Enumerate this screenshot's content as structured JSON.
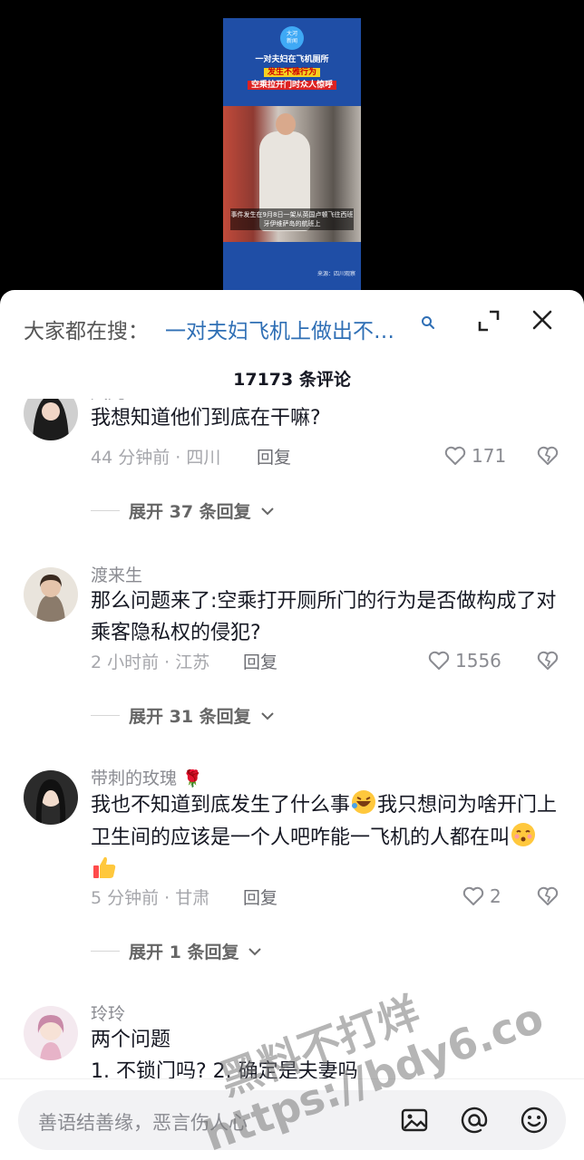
{
  "video": {
    "logo": "大河\n新闻",
    "headline_1": "一对夫妇在飞机厕所",
    "headline_2": "发生不雅行为",
    "headline_3": "空乘拉开门时众人惊呼",
    "caption": "事件发生在9月8日一架从英国卢顿飞往西班牙伊维萨岛的航班上",
    "source": "来源：四川观察"
  },
  "header": {
    "search_prefix": "大家都在搜：",
    "search_term": "一对夫妇飞机上做出不…",
    "comment_count": "17173 条评论"
  },
  "comments": [
    {
      "username": "风儿",
      "text": "我想知道他们到底在干嘛?",
      "meta": "44 分钟前 · 四川",
      "reply": "回复",
      "likes": "171",
      "expand": "展开 37 条回复"
    },
    {
      "username": "渡来生",
      "text": "那么问题来了:空乘打开厕所门的行为是否做构成了对乘客隐私权的侵犯?",
      "meta": "2 小时前 · 江苏",
      "reply": "回复",
      "likes": "1556",
      "expand": "展开 31 条回复"
    },
    {
      "username": "带刺的玫瑰",
      "text_a": "我也不知道到底发生了什么事",
      "text_b": "我只想问为啥开门上卫生间的应该是一个人吧咋能一飞机的人都在叫",
      "meta": "5 分钟前 · 甘肃",
      "reply": "回复",
      "likes": "2",
      "expand": "展开 1 条回复"
    },
    {
      "username": "玲玲",
      "text": "两个问题",
      "text_line2": "1. 不锁门吗? 2. 确定是夫妻吗"
    }
  ],
  "input": {
    "placeholder": "善语结善缘，恶言伤人心"
  },
  "watermark": {
    "line1": "黑料不打烊",
    "line2": "https://bdy6.co"
  }
}
